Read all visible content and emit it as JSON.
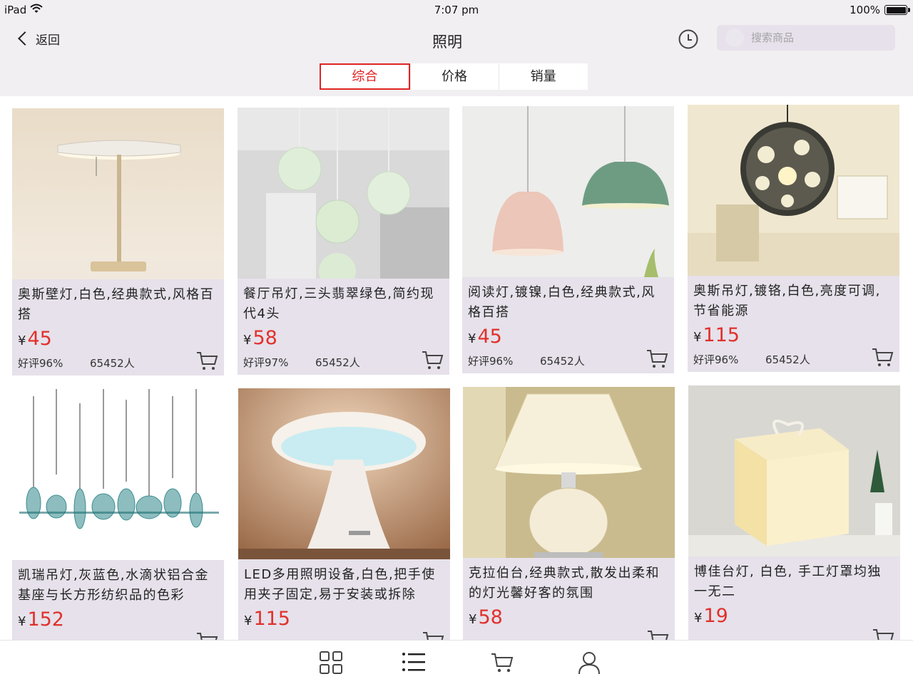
{
  "status_bar": {
    "carrier": "iPad",
    "time": "7:07 pm",
    "battery": "100%"
  },
  "header": {
    "back_label": "返回",
    "title": "照明",
    "search_placeholder": "搜索商品"
  },
  "sort_tabs": [
    {
      "label": "综合",
      "active": true
    },
    {
      "label": "价格",
      "active": false
    },
    {
      "label": "销量",
      "active": false
    }
  ],
  "products": [
    {
      "name": "奥斯壁灯,白色,经典款式,风格百搭",
      "currency": "¥",
      "price": "45",
      "rating": "好评96%",
      "buyers": "65452人"
    },
    {
      "name": "餐厅吊灯,三头翡翠绿色,简约现代4头",
      "currency": "¥",
      "price": "58",
      "rating": "好评97%",
      "buyers": "65452人"
    },
    {
      "name": "阅读灯,镀镍,白色,经典款式,风格百搭",
      "currency": "¥",
      "price": "45",
      "rating": "好评96%",
      "buyers": "65452人"
    },
    {
      "name": "奥斯吊灯,镀铬,白色,亮度可调,节省能源",
      "currency": "¥",
      "price": "115",
      "rating": "好评96%",
      "buyers": "65452人"
    },
    {
      "name": "凯瑞吊灯,灰蓝色,水滴状铝合金基座与长方形纺织品的色彩",
      "currency": "¥",
      "price": "152",
      "rating": "",
      "buyers": ""
    },
    {
      "name": "LED多用照明设备,白色,把手使用夹子固定,易于安装或拆除",
      "currency": "¥",
      "price": "115",
      "rating": "",
      "buyers": ""
    },
    {
      "name": "克拉伯台,经典款式,散发出柔和的灯光馨好客的氛围",
      "currency": "¥",
      "price": "58",
      "rating": "",
      "buyers": ""
    },
    {
      "name": "博佳台灯, 白色, 手工灯罩均独一无二",
      "currency": "¥",
      "price": "19",
      "rating": "",
      "buyers": ""
    }
  ],
  "bottom_nav": [
    {
      "icon": "grid-icon"
    },
    {
      "icon": "list-icon"
    },
    {
      "icon": "cart-icon"
    },
    {
      "icon": "user-icon"
    }
  ],
  "colors": {
    "accent": "#e02424",
    "price": "#e0312c",
    "card_background": "#e6e1ea",
    "header_background": "#f2eff2"
  }
}
